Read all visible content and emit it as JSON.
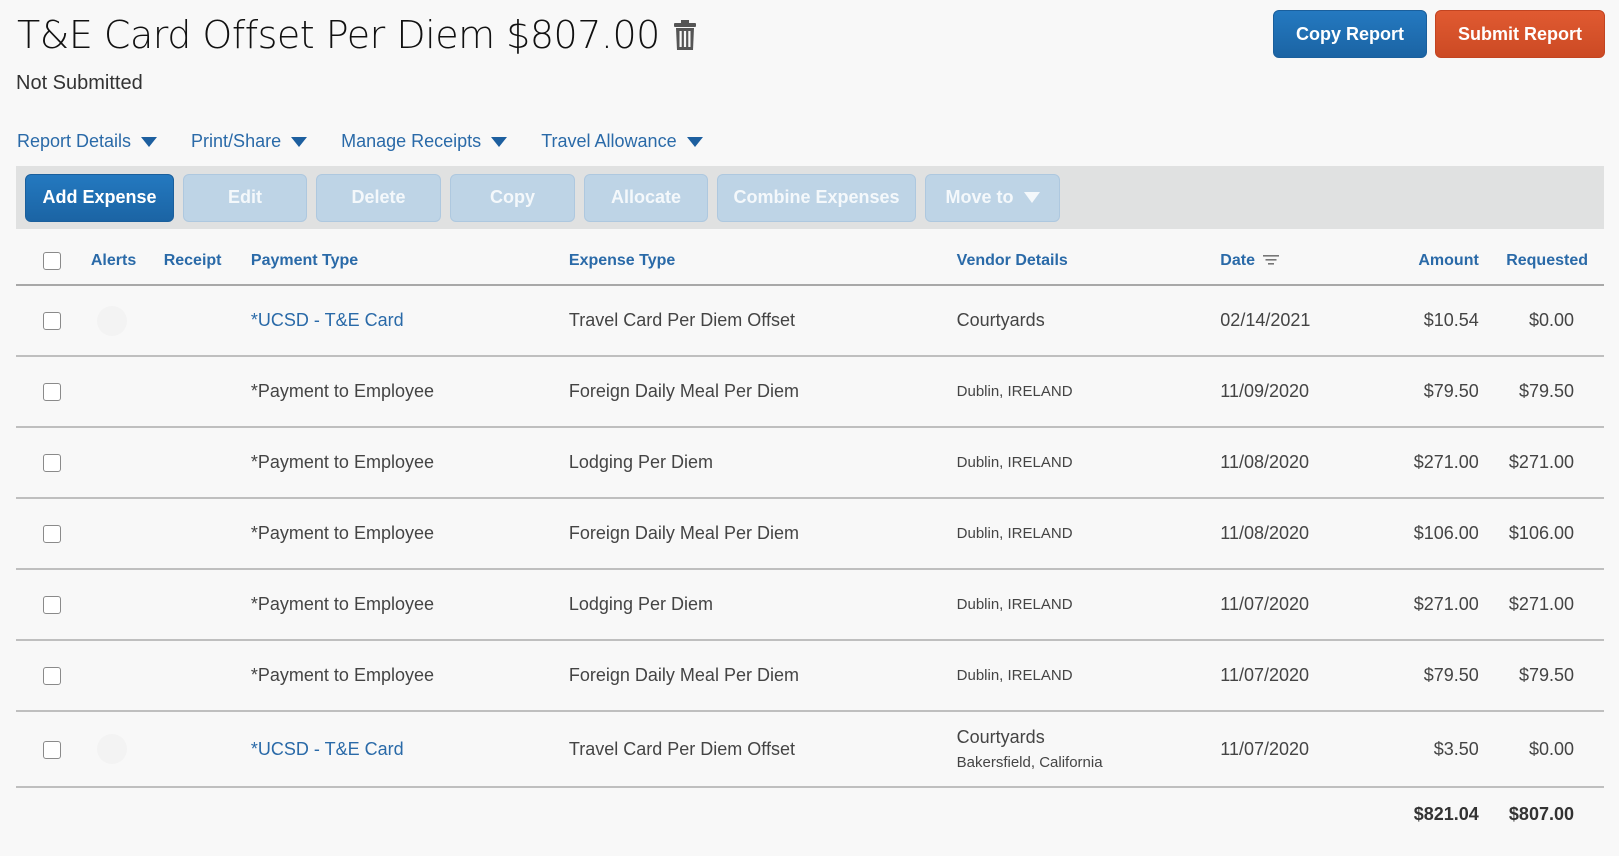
{
  "header": {
    "title": "T&E Card Offset Per Diem $807.00",
    "status": "Not Submitted",
    "delete_icon": "trash-icon",
    "copy_report_label": "Copy Report",
    "submit_report_label": "Submit Report"
  },
  "colors": {
    "primary_blue": "#1f6fb2",
    "submit_orange": "#d9532c",
    "link_blue": "#2a6aa8",
    "disabled_button": "#bed4e6",
    "toolbar_bg": "#e0e1e1",
    "page_bg": "#f8f8f8"
  },
  "menus": [
    {
      "label": "Report Details",
      "icon": "caret-down-icon"
    },
    {
      "label": "Print/Share",
      "icon": "caret-down-icon"
    },
    {
      "label": "Manage Receipts",
      "icon": "caret-down-icon"
    },
    {
      "label": "Travel Allowance",
      "icon": "caret-down-icon"
    }
  ],
  "toolbar": {
    "add_expense": "Add Expense",
    "edit": "Edit",
    "delete": "Delete",
    "copy": "Copy",
    "allocate": "Allocate",
    "combine_expenses": "Combine Expenses",
    "move_to": "Move to"
  },
  "table": {
    "columns": {
      "alerts": "Alerts",
      "receipt": "Receipt",
      "payment_type": "Payment Type",
      "expense_type": "Expense Type",
      "vendor_details": "Vendor Details",
      "date": "Date",
      "amount": "Amount",
      "requested": "Requested"
    },
    "rows": [
      {
        "payment_type": "*UCSD - T&E Card",
        "expense_type": "Travel Card Per Diem Offset",
        "vendor": "Courtyards",
        "vendor_location": "",
        "date": "02/14/2021",
        "amount": "$10.54",
        "requested": "$0.00"
      },
      {
        "payment_type": "*Payment to Employee",
        "expense_type": "Foreign Daily Meal Per Diem",
        "vendor": "",
        "vendor_location": "Dublin, IRELAND",
        "date": "11/09/2020",
        "amount": "$79.50",
        "requested": "$79.50"
      },
      {
        "payment_type": "*Payment to Employee",
        "expense_type": "Lodging Per Diem",
        "vendor": "",
        "vendor_location": "Dublin, IRELAND",
        "date": "11/08/2020",
        "amount": "$271.00",
        "requested": "$271.00"
      },
      {
        "payment_type": "*Payment to Employee",
        "expense_type": "Foreign Daily Meal Per Diem",
        "vendor": "",
        "vendor_location": "Dublin, IRELAND",
        "date": "11/08/2020",
        "amount": "$106.00",
        "requested": "$106.00"
      },
      {
        "payment_type": "*Payment to Employee",
        "expense_type": "Lodging Per Diem",
        "vendor": "",
        "vendor_location": "Dublin, IRELAND",
        "date": "11/07/2020",
        "amount": "$271.00",
        "requested": "$271.00"
      },
      {
        "payment_type": "*Payment to Employee",
        "expense_type": "Foreign Daily Meal Per Diem",
        "vendor": "",
        "vendor_location": "Dublin, IRELAND",
        "date": "11/07/2020",
        "amount": "$79.50",
        "requested": "$79.50"
      },
      {
        "payment_type": "*UCSD - T&E Card",
        "expense_type": "Travel Card Per Diem Offset",
        "vendor": "Courtyards",
        "vendor_location": "Bakersfield, California",
        "date": "11/07/2020",
        "amount": "$3.50",
        "requested": "$0.00"
      }
    ],
    "totals": {
      "amount": "$821.04",
      "requested": "$807.00"
    }
  }
}
